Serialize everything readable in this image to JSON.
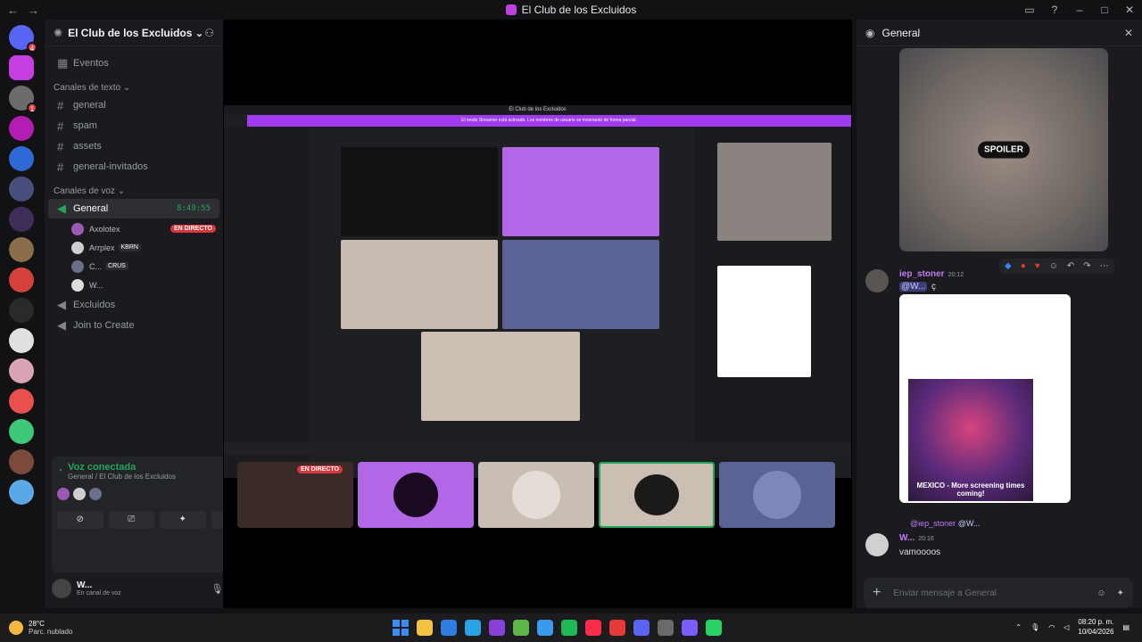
{
  "titlebar": {
    "title": "El Club de los Excluidos",
    "back": "←",
    "forward": "→"
  },
  "guilds": [
    {
      "color": "#5865f2",
      "badge": "4"
    },
    {
      "color": "#c53ee0",
      "badge": ""
    },
    {
      "color": "#6b6b6b",
      "badge": "1"
    },
    {
      "color": "#b21eb1",
      "badge": ""
    },
    {
      "color": "#2d6ad6",
      "badge": ""
    },
    {
      "color": "#4a4e7c",
      "badge": ""
    },
    {
      "color": "#3d2f5a",
      "badge": ""
    },
    {
      "color": "#8a6d4b",
      "badge": ""
    },
    {
      "color": "#d5423b",
      "badge": ""
    },
    {
      "color": "#2a2a2a",
      "badge": ""
    },
    {
      "color": "#e0e0e0",
      "badge": ""
    },
    {
      "color": "#d9a3b8",
      "badge": ""
    },
    {
      "color": "#e94f4f",
      "badge": ""
    },
    {
      "color": "#3cc77a",
      "badge": ""
    },
    {
      "color": "#7b4a3b",
      "badge": ""
    },
    {
      "color": "#5aa9e6",
      "badge": ""
    }
  ],
  "server": {
    "name": "El Club de los Excluidos",
    "events": "Eventos"
  },
  "text_category": "Canales de texto",
  "text_channels": [
    "general",
    "spam",
    "assets",
    "general-invitados"
  ],
  "voice_category": "Canales de voz",
  "voice_channel": {
    "name": "General",
    "timer": "8:49:55"
  },
  "voice_users": [
    {
      "name": "Axolotex",
      "live": "EN DIRECTO",
      "tag": "",
      "color": "#9b59b6"
    },
    {
      "name": "Arrplex",
      "live": "",
      "tag": "KBRN",
      "color": "#cfcfcf"
    },
    {
      "name": "C...",
      "live": "",
      "tag": "CRUS",
      "color": "#6a6f8a"
    },
    {
      "name": "W...",
      "live": "",
      "tag": "",
      "color": "#dddddd"
    }
  ],
  "other_voice": [
    "Excluidos",
    "Join to Create"
  ],
  "voice_panel": {
    "status": "Voz conectada",
    "location": "General / El Club de los Excluidos"
  },
  "user": {
    "name": "W...",
    "status": "En canal de voz"
  },
  "stage": {
    "inner_title": "El Club de los Excluidos",
    "inner_banner": "El modo Streamer está activado. Los nombres de usuario se mostrarán de forma parcial.",
    "thumb_live": "EN DIRECTO"
  },
  "right_panel": {
    "title": "General",
    "spoiler": "SPOILER",
    "msg1": {
      "author": "iep_stoner",
      "time": "20:12",
      "mention": "@W...",
      "tail": "ç"
    },
    "post_caption": "MEXICO - More screening times coming!",
    "reply_preview": "@iep_stoner",
    "reply_mention": "@W...",
    "msg2": {
      "author": "W...",
      "time": "20:16",
      "text": "vamoooos"
    },
    "composer_placeholder": "Enviar mensaje a General"
  },
  "taskbar": {
    "temp": "28°C",
    "weather": "Parc. nublado",
    "time": "08:20 p. m.",
    "date": "10/04/2026",
    "apps": [
      "#3a8bf2",
      "#f4c242",
      "#2f7de1",
      "#2aa3e6",
      "#8a3fd6",
      "#5bb547",
      "#3a9aeb",
      "#1db954",
      "#fa2d48",
      "#e53935",
      "#5865f2",
      "#6a6a6a",
      "#7c5cff",
      "#25d366"
    ]
  }
}
